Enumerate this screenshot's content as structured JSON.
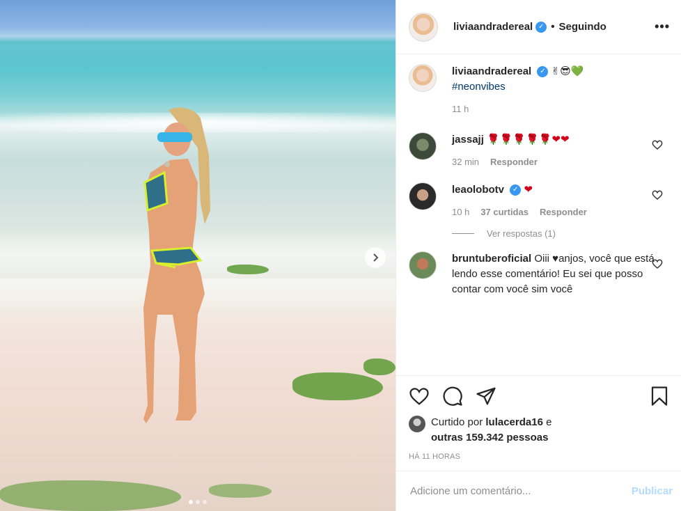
{
  "header": {
    "username": "liviaandradereal",
    "verified_icon": "verified-badge-icon",
    "separator": "•",
    "follow_status": "Seguindo",
    "more_icon": "more-options-icon"
  },
  "caption": {
    "username": "liviaandradereal",
    "emojis": "✌😎💚",
    "hashtag": "#neonvibes",
    "time": "11 h"
  },
  "comments": [
    {
      "username": "jassajj",
      "text": "🌹🌹🌹🌹🌹❤❤",
      "time": "32 min",
      "likes": "",
      "reply": "Responder"
    },
    {
      "username": "leaolobotv",
      "text": "❤",
      "time": "10 h",
      "likes": "37 curtidas",
      "reply": "Responder",
      "view_replies": "Ver respostas (1)"
    },
    {
      "username": "bruntuberoficial",
      "text": "Oiii ♥anjos, você que está lendo esse comentário! Eu sei que posso contar com você sim você"
    }
  ],
  "actions": {
    "liked_by_prefix": "Curtido por",
    "liked_by_user": "lulacerda16",
    "liked_by_and": "e",
    "likes_other": "outras 159.342 pessoas",
    "timestamp": "HÁ 11 HORAS"
  },
  "comment_box": {
    "placeholder": "Adicione um comentário...",
    "publish": "Publicar"
  },
  "colors": {
    "link": "#00376b",
    "verified": "#3897f0",
    "publish_disabled": "#b3dbff",
    "muted": "#8e8e8e"
  },
  "carousel": {
    "slides": 3,
    "current": 1
  }
}
